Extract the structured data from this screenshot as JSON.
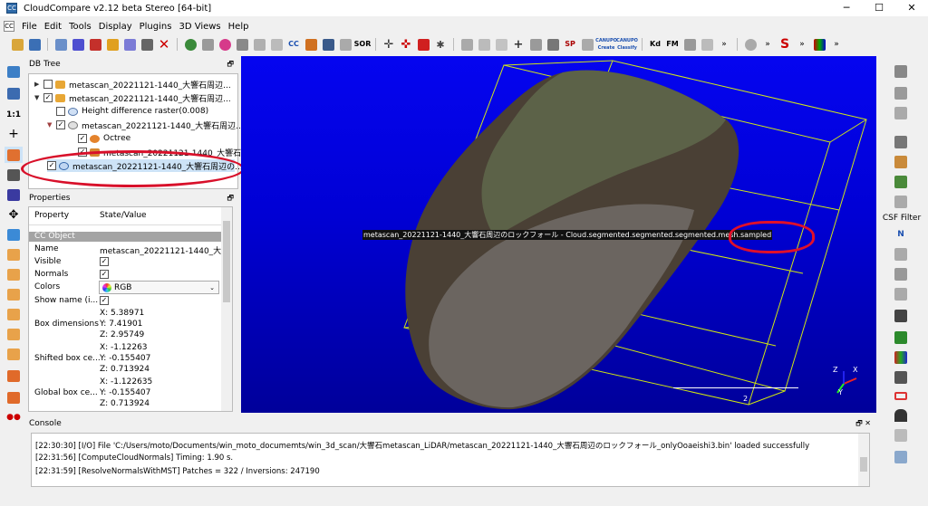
{
  "window": {
    "title": "CloudCompare v2.12 beta Stereo [64-bit]",
    "app_icon": "CC",
    "controls": [
      "─",
      "☐",
      "✕"
    ]
  },
  "menu": [
    "File",
    "Edit",
    "Tools",
    "Display",
    "Plugins",
    "3D Views",
    "Help"
  ],
  "toolbar_labels": {
    "cc": "CC",
    "sor": "SOR",
    "sp": "SP",
    "canupo1": "CANUPO Create",
    "canupo2": "CANUPO Classify",
    "kd": "Kd",
    "fm": "FM"
  },
  "db_tree": {
    "title": "DB Tree",
    "float_icon": "🗗",
    "items": [
      {
        "label": "metascan_20221121-1440_大響石周辺...",
        "arrow": "▶",
        "checked": false
      },
      {
        "label": "metascan_20221121-1440_大響石周辺...",
        "arrow": "▼",
        "checked": true
      },
      {
        "label": "Height difference raster(0.008)",
        "arrow": "",
        "checked": false
      },
      {
        "label": "metascan_20221121-1440_大響石周辺...",
        "arrow": "▼",
        "checked": true
      },
      {
        "label": "Octree",
        "arrow": "",
        "checked": true
      },
      {
        "label": "metascan_20221121-1440_大響石...",
        "arrow": "",
        "checked": true
      },
      {
        "label": "metascan_20221121-1440_大響石周辺の...",
        "arrow": "",
        "checked": true
      }
    ]
  },
  "properties": {
    "title": "Properties",
    "float_icon": "🗗",
    "headers": [
      "Property",
      "State/Value"
    ],
    "group": "CC Object",
    "name": {
      "label": "Name",
      "value": "metascan_20221121-1440_大..."
    },
    "visible": {
      "label": "Visible",
      "value": "✓"
    },
    "normals": {
      "label": "Normals",
      "value": "✓"
    },
    "colors": {
      "label": "Colors",
      "value": "RGB"
    },
    "show_name": {
      "label": "Show name (i...",
      "value": "✓"
    },
    "box_dimensions": {
      "label": "Box dimensions",
      "x": "X: 5.38971",
      "y": "Y: 7.41901",
      "z": "Z: 2.95749"
    },
    "shifted_box": {
      "label": "Shifted box ce...",
      "x": "X: -1.12263",
      "y": "Y: -0.155407",
      "z": "Z: 0.713924"
    },
    "global_box": {
      "label": "Global box ce...",
      "x": "X: -1.122635",
      "y": "Y: -0.155407",
      "z": "Z: 0.713924"
    }
  },
  "viewport": {
    "cloud_label": "metascan_20221121-1440_大響石周辺のロックフォール - Cloud.segmented.segmented.segmented.mesh.sampled",
    "scale_value": "2",
    "axes": {
      "x": "X",
      "y": "Y",
      "z": "Z"
    }
  },
  "right_toolbar": {
    "csf_label": "CSF Filter",
    "normal_label": "N"
  },
  "console": {
    "title": "Console",
    "buttons": "🗗 ✕",
    "lines": [
      "[22:30:30] [I/O] File 'C:/Users/moto/Documents/win_moto_documemts/win_3d_scan/大響石metascan_LiDAR/metascan_20221121-1440_大響石周辺のロックフォール_onlyOoaeishi3.bin' loaded successfully",
      "[22:31:56] [ComputeCloudNormals] Timing: 1.90 s.",
      "[22:31:59] [ResolveNormalsWithMST] Patches = 322 / Inversions: 247190"
    ]
  },
  "colors": {
    "viewport_top": "#0505f0",
    "viewport_bottom": "#00009a",
    "annotation": "#d8102a",
    "bbox": "#e6ff00"
  }
}
